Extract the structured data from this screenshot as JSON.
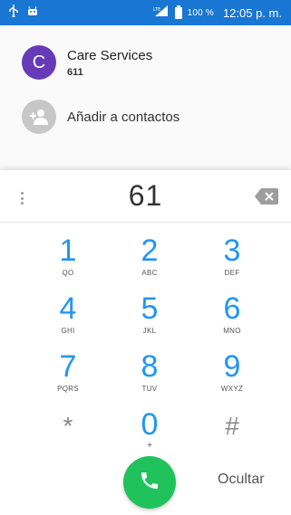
{
  "status_bar": {
    "battery_pct": "100 %",
    "time": "12:05 p. m.",
    "icons": [
      "usb-icon",
      "android-icon",
      "signal-icon",
      "battery-icon"
    ]
  },
  "suggestions": {
    "contact": {
      "initial": "C",
      "name": "Care Services",
      "number": "611",
      "avatar_color": "#673ab7"
    },
    "add_contact": {
      "label": "Añadir a contactos"
    }
  },
  "dialpad": {
    "digits": "61",
    "keys": [
      {
        "num": "1",
        "letters": "QO"
      },
      {
        "num": "2",
        "letters": "ABC"
      },
      {
        "num": "3",
        "letters": "DEF"
      },
      {
        "num": "4",
        "letters": "GHI"
      },
      {
        "num": "5",
        "letters": "JKL"
      },
      {
        "num": "6",
        "letters": "MNO"
      },
      {
        "num": "7",
        "letters": "PQRS"
      },
      {
        "num": "8",
        "letters": "TUV"
      },
      {
        "num": "9",
        "letters": "WXYZ"
      },
      {
        "num": "*",
        "letters": ""
      },
      {
        "num": "0",
        "letters": "+"
      },
      {
        "num": "#",
        "letters": ""
      }
    ],
    "hide_label": "Ocultar"
  },
  "colors": {
    "status_bar": "#1976d2",
    "digit_blue": "#2196f3",
    "call_green": "#20c25c",
    "avatar_purple": "#673ab7"
  }
}
